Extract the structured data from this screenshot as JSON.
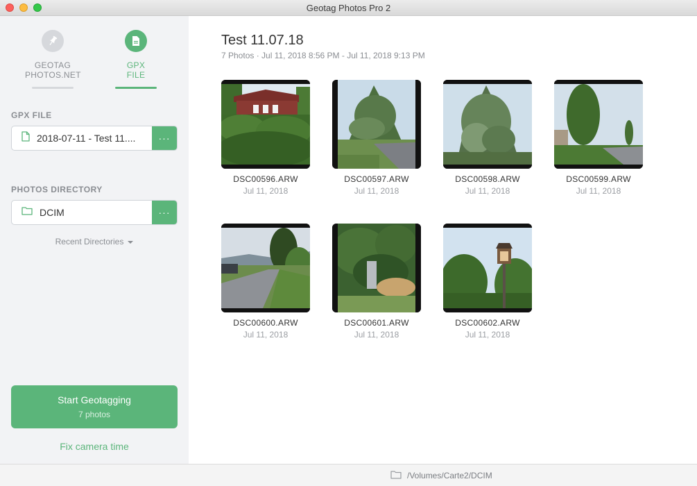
{
  "window": {
    "title": "Geotag Photos Pro 2"
  },
  "sidebar": {
    "tabs": [
      {
        "label_line1": "GEOTAG",
        "label_line2": "PHOTOS.NET",
        "icon": "pin-icon",
        "active": false
      },
      {
        "label_line1": "GPX",
        "label_line2": "FILE",
        "icon": "file-icon",
        "active": true
      }
    ],
    "gpx_section_label": "GPX FILE",
    "gpx_file_value": "2018-07-11 - Test 11....",
    "gpx_more_label": "···",
    "photos_section_label": "PHOTOS DIRECTORY",
    "photos_dir_value": "DCIM",
    "photos_more_label": "···",
    "recent_label": "Recent Directories",
    "start_label": "Start Geotagging",
    "start_sub": "7 photos",
    "fix_label": "Fix camera time"
  },
  "main": {
    "title": "Test 11.07.18",
    "subtitle": "7 Photos · Jul 11, 2018 8:56 PM - Jul 11, 2018 9:13 PM",
    "photos": [
      {
        "name": "DSC00596.ARW",
        "date": "Jul 11, 2018"
      },
      {
        "name": "DSC00597.ARW",
        "date": "Jul 11, 2018"
      },
      {
        "name": "DSC00598.ARW",
        "date": "Jul 11, 2018"
      },
      {
        "name": "DSC00599.ARW",
        "date": "Jul 11, 2018"
      },
      {
        "name": "DSC00600.ARW",
        "date": "Jul 11, 2018"
      },
      {
        "name": "DSC00601.ARW",
        "date": "Jul 11, 2018"
      },
      {
        "name": "DSC00602.ARW",
        "date": "Jul 11, 2018"
      }
    ]
  },
  "statusbar": {
    "path": "/Volumes/Carte2/DCIM"
  },
  "colors": {
    "accent": "#5bb57a",
    "sidebar_bg": "#f2f3f5",
    "muted_text": "#8a8d92"
  }
}
